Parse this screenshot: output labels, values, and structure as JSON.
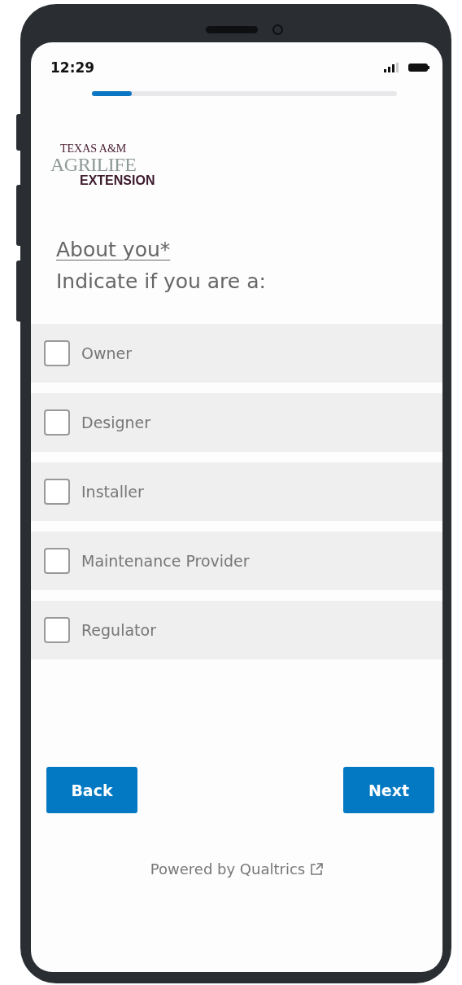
{
  "status_bar": {
    "time": "12:29"
  },
  "progress": {
    "level": 0.13
  },
  "logo": {
    "top": "TEXAS A&M",
    "middle": "AGRILIFE",
    "bottom": "EXTENSION"
  },
  "question": {
    "title": "About you*",
    "prompt": "Indicate if you are a:"
  },
  "options": [
    {
      "label": "Owner",
      "checked": false
    },
    {
      "label": "Designer",
      "checked": false
    },
    {
      "label": "Installer",
      "checked": false
    },
    {
      "label": "Maintenance Provider",
      "checked": false
    },
    {
      "label": "Regulator",
      "checked": false
    }
  ],
  "buttons": [
    {
      "label": "Back"
    },
    {
      "label": "Next"
    }
  ],
  "footer": {
    "text": "Powered by Qualtrics"
  }
}
